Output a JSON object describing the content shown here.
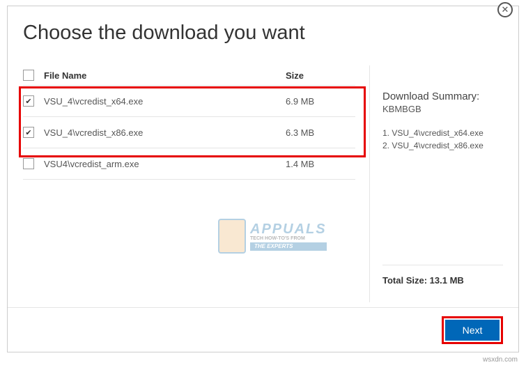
{
  "title": "Choose the download you want",
  "header": {
    "filename_label": "File Name",
    "size_label": "Size"
  },
  "files": [
    {
      "name": "VSU_4\\vcredist_x64.exe",
      "size": "6.9 MB",
      "checked": true
    },
    {
      "name": "VSU_4\\vcredist_x86.exe",
      "size": "6.3 MB",
      "checked": true
    },
    {
      "name": "VSU4\\vcredist_arm.exe",
      "size": "1.4 MB",
      "checked": false
    }
  ],
  "summary": {
    "title": "Download Summary:",
    "sub": "KBMBGB",
    "items": [
      "1. VSU_4\\vcredist_x64.exe",
      "2. VSU_4\\vcredist_x86.exe"
    ],
    "total_label": "Total Size: 13.1 MB"
  },
  "buttons": {
    "next": "Next"
  },
  "watermark": {
    "brand": "APPUALS",
    "tag1": "TECH HOW-TO'S FROM",
    "tag2": "THE EXPERTS"
  },
  "srcmark": "wsxdn.com"
}
